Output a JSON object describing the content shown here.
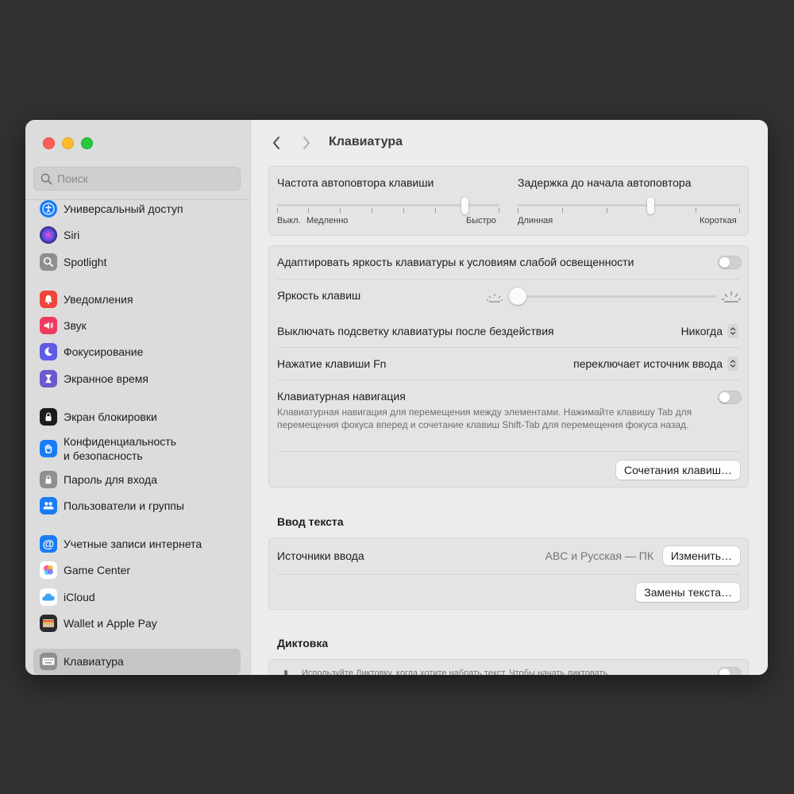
{
  "search": {
    "placeholder": "Поиск"
  },
  "sidebar": {
    "items": [
      {
        "label": "Универсальный доступ",
        "icon": "accessibility-icon",
        "color": "#1a7cf5"
      },
      {
        "label": "Siri",
        "icon": "siri-icon",
        "color": "#3a3a6a"
      },
      {
        "label": "Spotlight",
        "icon": "spotlight-icon",
        "color": "#8e8e93"
      },
      {
        "label": "Уведомления",
        "icon": "notifications-icon",
        "color": "#f0453a"
      },
      {
        "label": "Звук",
        "icon": "sound-icon",
        "color": "#f03a5f"
      },
      {
        "label": "Фокусирование",
        "icon": "focus-icon",
        "color": "#5e5ce6"
      },
      {
        "label": "Экранное время",
        "icon": "screen-time-icon",
        "color": "#6a5acd"
      },
      {
        "label": "Экран блокировки",
        "icon": "lock-screen-icon",
        "color": "#1c1c1e"
      },
      {
        "label": "Конфиденциальность",
        "label2": "и безопасность",
        "icon": "privacy-hand-icon",
        "color": "#1a7cf5"
      },
      {
        "label": "Пароль для входа",
        "icon": "password-lock-icon",
        "color": "#8e8e93"
      },
      {
        "label": "Пользователи и группы",
        "icon": "users-icon",
        "color": "#1a7cf5"
      },
      {
        "label": "Учетные записи интернета",
        "icon": "internet-accounts-icon",
        "color": "#1a7cf5"
      },
      {
        "label": "Game Center",
        "icon": "game-center-icon",
        "color": "#ffffff"
      },
      {
        "label": "iCloud",
        "icon": "icloud-icon",
        "color": "#ffffff"
      },
      {
        "label": "Wallet и Apple Pay",
        "icon": "wallet-icon",
        "color": "#2c2c2e"
      },
      {
        "label": "Клавиатура",
        "icon": "keyboard-icon",
        "color": "#8e8e93",
        "selected": true
      }
    ]
  },
  "header": {
    "title": "Клавиатура"
  },
  "repeat": {
    "rate_label": "Частота автоповтора клавиши",
    "rate_min": "Выкл.",
    "rate_slow": "Медленно",
    "rate_fast": "Быстро",
    "rate_value": 0.857,
    "delay_label": "Задержка до начала автоповтора",
    "delay_long": "Длинная",
    "delay_short": "Короткая",
    "delay_value": 0.6
  },
  "backlight": {
    "adapt_label": "Адаптировать яркость клавиатуры к условиям слабой освещенности",
    "adapt_on": false,
    "brightness_label": "Яркость клавиш",
    "brightness_value": 0.0,
    "off_label": "Выключать подсветку клавиатуры после бездействия",
    "off_value": "Никогда",
    "fn_label": "Нажатие клавиши Fn",
    "fn_value": "переключает источник ввода",
    "nav_label": "Клавиатурная навигация",
    "nav_on": false,
    "nav_desc": "Клавиатурная навигация для перемещения между элементами. Нажимайте клавишу Tab для перемещения фокуса вперед и сочетание клавиш Shift-Tab для перемещения фокуса назад.",
    "shortcuts_button": "Сочетания клавиш…"
  },
  "text_input": {
    "section_title": "Ввод текста",
    "sources_label": "Источники ввода",
    "sources_value": "ABC и Русская — ПК",
    "change_button": "Изменить…",
    "replacements_button": "Замены текста…"
  },
  "dictation": {
    "section_title": "Диктовка",
    "desc": "Используйте Диктовку, когда хотите набрать текст. Чтобы начать диктовать,"
  }
}
